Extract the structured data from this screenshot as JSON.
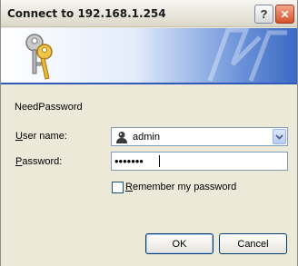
{
  "window": {
    "title": "Connect to 192.168.1.254",
    "help_glyph": "?",
    "close_glyph": "✕"
  },
  "banner": {
    "icon": "keys-icon",
    "colors": {
      "light": "#ffffff",
      "dark": "#3b69c4"
    }
  },
  "message": "NeedPassword",
  "username": {
    "label_first": "U",
    "label_rest": "ser name:",
    "value": "admin",
    "icon": "user-icon"
  },
  "password": {
    "label_first": "P",
    "label_rest": "assword:",
    "masked_value": "•••••••"
  },
  "remember": {
    "label_first": "R",
    "label_rest": "emember my password",
    "checked": false
  },
  "buttons": {
    "ok": "OK",
    "cancel": "Cancel"
  }
}
